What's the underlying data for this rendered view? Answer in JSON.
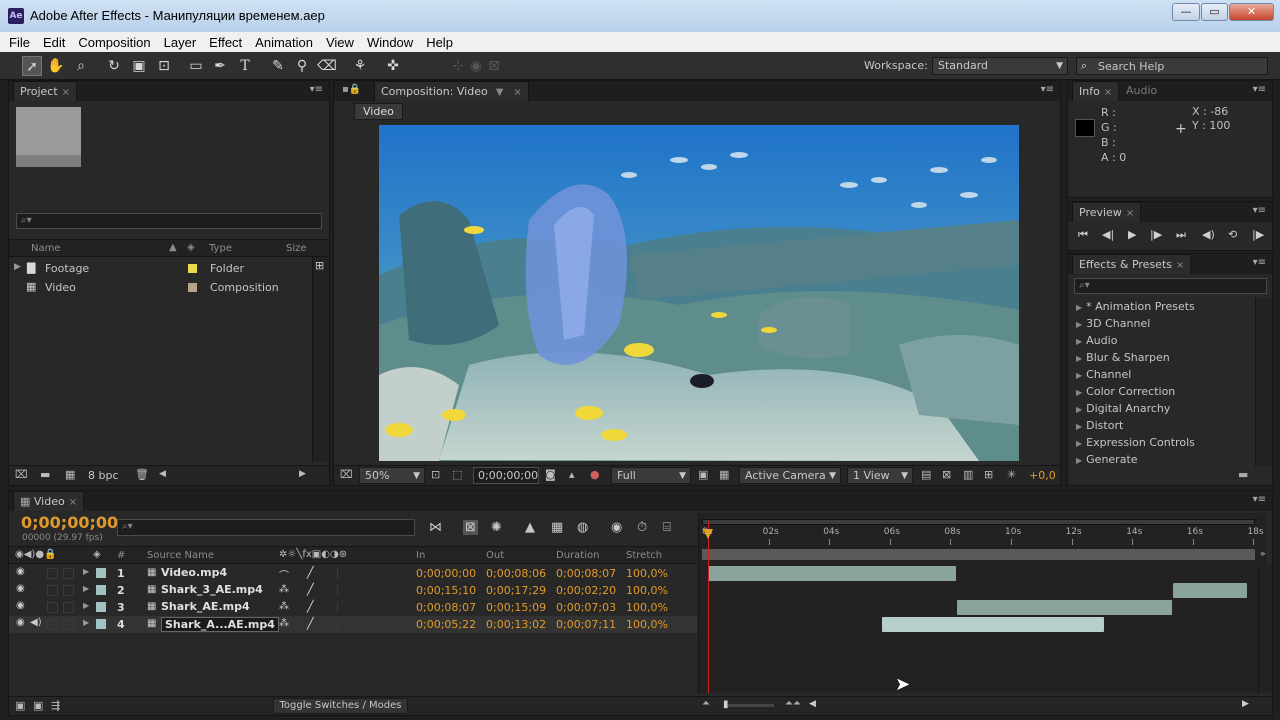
{
  "window": {
    "app_icon": "Ae",
    "title": "Adobe After Effects - Манипуляции временем.aep",
    "controls": [
      "minimize-icon",
      "maximize-icon",
      "close-icon"
    ]
  },
  "menu": [
    "File",
    "Edit",
    "Composition",
    "Layer",
    "Effect",
    "Animation",
    "View",
    "Window",
    "Help"
  ],
  "toolbar": {
    "workspace_label": "Workspace:",
    "workspace_value": "Standard",
    "search_help": "Search Help"
  },
  "project": {
    "tab": "Project",
    "columns": {
      "name": "Name",
      "type": "Type",
      "size": "Size"
    },
    "items": [
      {
        "name": "Footage",
        "type": "Folder",
        "color": "#e8d84a"
      },
      {
        "name": "Video",
        "type": "Composition",
        "color": "#b5a58a"
      }
    ],
    "bpc": "8 bpc"
  },
  "composition": {
    "tab": "Composition: Video",
    "subtab": "Video",
    "zoom": "50%",
    "timecode": "0;00;00;00",
    "resolution": "Full",
    "camera": "Active Camera",
    "views": "1 View",
    "offset": "+0,0"
  },
  "info": {
    "tab": "Info",
    "tab2": "Audio",
    "r": "R :",
    "g": "G :",
    "b": "B :",
    "a": "A : 0",
    "x": "X : -86",
    "y": "Y : 100"
  },
  "preview": {
    "tab": "Preview"
  },
  "effects": {
    "tab": "Effects & Presets",
    "items": [
      "* Animation Presets",
      "3D Channel",
      "Audio",
      "Blur & Sharpen",
      "Channel",
      "Color Correction",
      "Digital Anarchy",
      "Distort",
      "Expression Controls",
      "Generate"
    ]
  },
  "timeline": {
    "tab": "Video",
    "timecode": "0;00;00;00",
    "fps": "00000 (29.97 fps)",
    "columns": {
      "num": "#",
      "source": "Source Name",
      "in": "In",
      "out": "Out",
      "duration": "Duration",
      "stretch": "Stretch"
    },
    "ruler": [
      "0s",
      "02s",
      "04s",
      "06s",
      "08s",
      "10s",
      "12s",
      "14s",
      "16s",
      "18s"
    ],
    "layers": [
      {
        "num": "1",
        "name": "Video.mp4",
        "in": "0;00;00;00",
        "out": "0;00;08;06",
        "duration": "0;00;08;07",
        "stretch": "100,0%"
      },
      {
        "num": "2",
        "name": "Shark_3_AE.mp4",
        "in": "0;00;15;10",
        "out": "0;00;17;29",
        "duration": "0;00;02;20",
        "stretch": "100,0%"
      },
      {
        "num": "3",
        "name": "Shark_AE.mp4",
        "in": "0;00;08;07",
        "out": "0;00;15;09",
        "duration": "0;00;07;03",
        "stretch": "100,0%"
      },
      {
        "num": "4",
        "name": "Shark_A...AE.mp4",
        "in": "0;00;05;22",
        "out": "0;00;13;02",
        "duration": "0;00;07;11",
        "stretch": "100,0%"
      }
    ],
    "toggle_label": "Toggle Switches / Modes"
  }
}
